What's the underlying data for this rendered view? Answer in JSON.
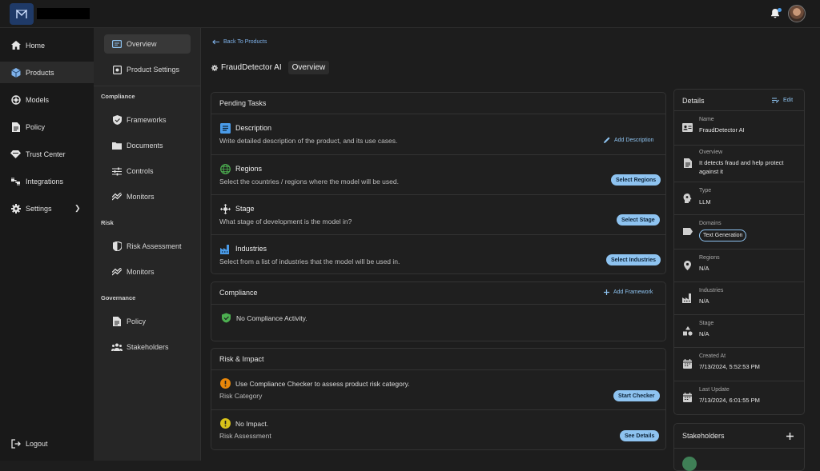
{
  "nav": {
    "items": [
      {
        "label": "Home",
        "icon": "home-icon"
      },
      {
        "label": "Products",
        "icon": "cube-icon"
      },
      {
        "label": "Models",
        "icon": "models-icon"
      },
      {
        "label": "Policy",
        "icon": "policy-icon"
      },
      {
        "label": "Trust Center",
        "icon": "trust-center-icon"
      },
      {
        "label": "Integrations",
        "icon": "integrations-icon"
      },
      {
        "label": "Settings",
        "icon": "gear-icon"
      }
    ],
    "logout": "Logout"
  },
  "subnav": {
    "overview": "Overview",
    "product_settings": "Product Settings",
    "compliance_heading": "Compliance",
    "frameworks": "Frameworks",
    "documents": "Documents",
    "controls": "Controls",
    "monitors": "Monitors",
    "risk_heading": "Risk",
    "risk_assessment": "Risk Assessment",
    "risk_monitors": "Monitors",
    "governance_heading": "Governance",
    "policy": "Policy",
    "stakeholders": "Stakeholders"
  },
  "main": {
    "back_label": "Back To Products",
    "product_name": "FraudDetector AI",
    "breadcrumb_page": "Overview",
    "pending": {
      "title": "Pending Tasks",
      "tasks": [
        {
          "title": "Description",
          "desc": "Write detailed description of the product, and its use cases.",
          "action": "Add Description"
        },
        {
          "title": "Regions",
          "desc": "Select the countries / regions where the model will be used.",
          "action": "Select Regions"
        },
        {
          "title": "Stage",
          "desc": "What stage of development is the model in?",
          "action": "Select Stage"
        },
        {
          "title": "Industries",
          "desc": "Select from a list of industries that the model will be used in.",
          "action": "Select Industries"
        }
      ]
    },
    "compliance": {
      "title": "Compliance",
      "action": "Add Framework",
      "empty": "No Compliance Activity."
    },
    "risk": {
      "title": "Risk & Impact",
      "category_msg": "Use Compliance Checker to assess product risk category.",
      "category_label": "Risk Category",
      "category_action": "Start Checker",
      "assessment_msg": "No Impact.",
      "assessment_label": "Risk Assessment",
      "assessment_action": "See Details"
    },
    "details": {
      "title": "Details",
      "edit": "Edit",
      "name_label": "Name",
      "name_value": "FraudDetector AI",
      "overview_label": "Overview",
      "overview_value": "It detects fraud and help protect against it",
      "type_label": "Type",
      "type_value": "LLM",
      "domains_label": "Domains",
      "domains_value": "Text Generation",
      "regions_label": "Regions",
      "regions_value": "N/A",
      "industries_label": "Industries",
      "industries_value": "N/A",
      "stage_label": "Stage",
      "stage_value": "N/A",
      "created_label": "Created At",
      "created_value": "7/13/2024, 5:52:53 PM",
      "updated_label": "Last Update",
      "updated_value": "7/13/2024, 6:01:55 PM"
    },
    "stakeholders": {
      "title": "Stakeholders"
    }
  },
  "colors": {
    "accent": "#8ec3f0",
    "link": "#7fb2ea",
    "logo_bg": "#1f3a68"
  }
}
